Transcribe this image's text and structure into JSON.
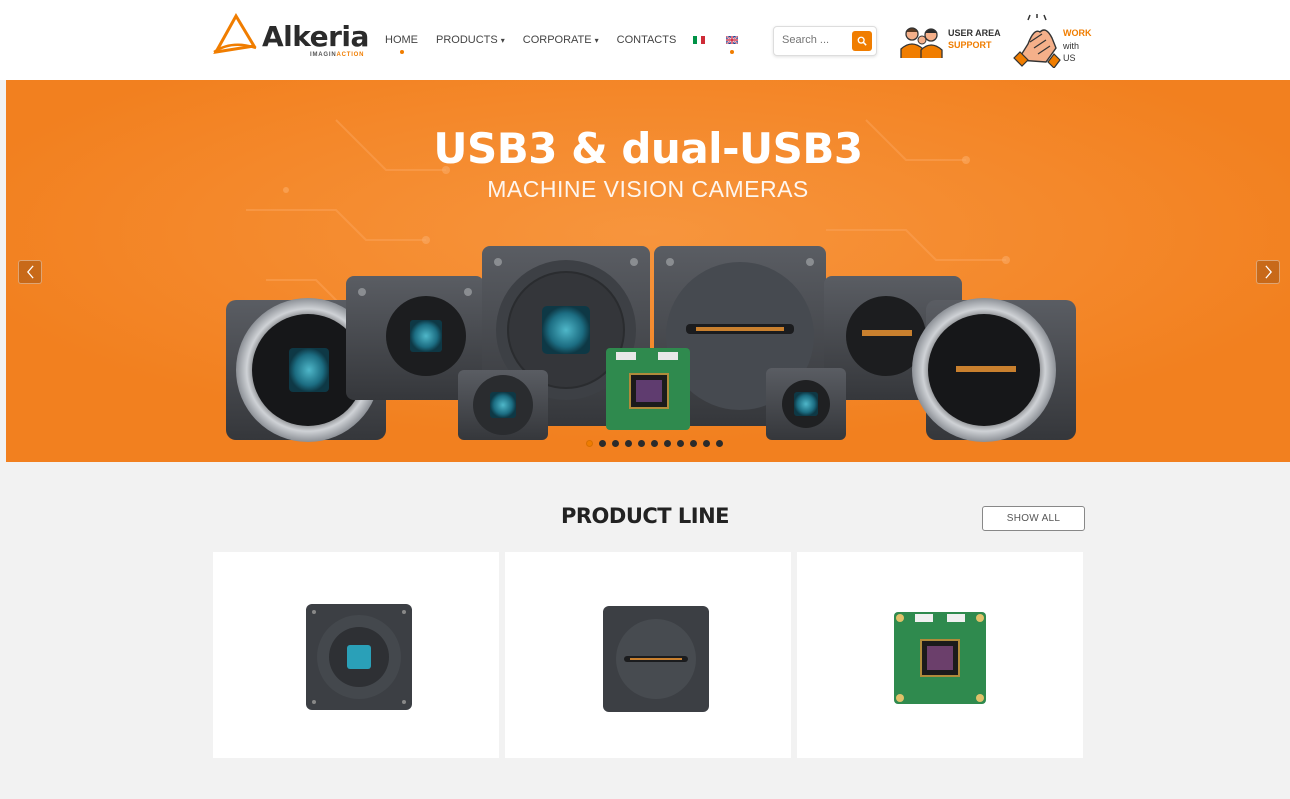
{
  "header": {
    "logo": {
      "word": "Alkeria",
      "tagline_a": "IMAGIN",
      "tagline_b": "ACTION"
    },
    "nav": [
      {
        "label": "HOME",
        "active": true
      },
      {
        "label": "PRODUCTS",
        "dropdown": true
      },
      {
        "label": "CORPORATE",
        "dropdown": true
      },
      {
        "label": "CONTACTS"
      }
    ],
    "languages": [
      {
        "code": "it",
        "icon": "italian-flag-icon"
      },
      {
        "code": "en",
        "icon": "uk-flag-icon",
        "active": true
      }
    ],
    "search": {
      "placeholder": "Search ...",
      "icon": "search-icon"
    },
    "user_area": {
      "line1": "USER AREA",
      "line2": "SUPPORT",
      "icon": "users-group-icon"
    },
    "work": {
      "line1": "WORK",
      "line2": "with",
      "line3": "US",
      "icon": "handshake-icon"
    }
  },
  "hero": {
    "title": "USB3 & dual-USB3",
    "subtitle": "MACHINE VISION CAMERAS",
    "prev_icon": "chevron-left-icon",
    "next_icon": "chevron-right-icon",
    "slide_count": 11,
    "active_slide": 1
  },
  "product_line": {
    "title": "PRODUCT LINE",
    "show_all": "SHOW ALL",
    "cards": [
      {
        "icon": "camera-sensor-round-icon"
      },
      {
        "icon": "camera-line-scan-icon"
      },
      {
        "icon": "board-camera-icon"
      }
    ]
  },
  "colors": {
    "accent": "#f07d00",
    "hero_bg": "#f5882a",
    "page_bg": "#f2f2f2",
    "text_dark": "#222222"
  }
}
